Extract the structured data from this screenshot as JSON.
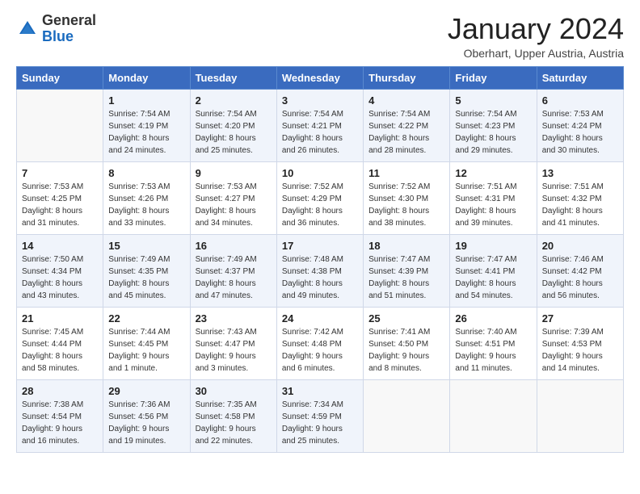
{
  "logo": {
    "general": "General",
    "blue": "Blue"
  },
  "header": {
    "title": "January 2024",
    "location": "Oberhart, Upper Austria, Austria"
  },
  "weekdays": [
    "Sunday",
    "Monday",
    "Tuesday",
    "Wednesday",
    "Thursday",
    "Friday",
    "Saturday"
  ],
  "weeks": [
    [
      {
        "day": "",
        "sunrise": "",
        "sunset": "",
        "daylight": ""
      },
      {
        "day": "1",
        "sunrise": "Sunrise: 7:54 AM",
        "sunset": "Sunset: 4:19 PM",
        "daylight": "Daylight: 8 hours and 24 minutes."
      },
      {
        "day": "2",
        "sunrise": "Sunrise: 7:54 AM",
        "sunset": "Sunset: 4:20 PM",
        "daylight": "Daylight: 8 hours and 25 minutes."
      },
      {
        "day": "3",
        "sunrise": "Sunrise: 7:54 AM",
        "sunset": "Sunset: 4:21 PM",
        "daylight": "Daylight: 8 hours and 26 minutes."
      },
      {
        "day": "4",
        "sunrise": "Sunrise: 7:54 AM",
        "sunset": "Sunset: 4:22 PM",
        "daylight": "Daylight: 8 hours and 28 minutes."
      },
      {
        "day": "5",
        "sunrise": "Sunrise: 7:54 AM",
        "sunset": "Sunset: 4:23 PM",
        "daylight": "Daylight: 8 hours and 29 minutes."
      },
      {
        "day": "6",
        "sunrise": "Sunrise: 7:53 AM",
        "sunset": "Sunset: 4:24 PM",
        "daylight": "Daylight: 8 hours and 30 minutes."
      }
    ],
    [
      {
        "day": "7",
        "sunrise": "Sunrise: 7:53 AM",
        "sunset": "Sunset: 4:25 PM",
        "daylight": "Daylight: 8 hours and 31 minutes."
      },
      {
        "day": "8",
        "sunrise": "Sunrise: 7:53 AM",
        "sunset": "Sunset: 4:26 PM",
        "daylight": "Daylight: 8 hours and 33 minutes."
      },
      {
        "day": "9",
        "sunrise": "Sunrise: 7:53 AM",
        "sunset": "Sunset: 4:27 PM",
        "daylight": "Daylight: 8 hours and 34 minutes."
      },
      {
        "day": "10",
        "sunrise": "Sunrise: 7:52 AM",
        "sunset": "Sunset: 4:29 PM",
        "daylight": "Daylight: 8 hours and 36 minutes."
      },
      {
        "day": "11",
        "sunrise": "Sunrise: 7:52 AM",
        "sunset": "Sunset: 4:30 PM",
        "daylight": "Daylight: 8 hours and 38 minutes."
      },
      {
        "day": "12",
        "sunrise": "Sunrise: 7:51 AM",
        "sunset": "Sunset: 4:31 PM",
        "daylight": "Daylight: 8 hours and 39 minutes."
      },
      {
        "day": "13",
        "sunrise": "Sunrise: 7:51 AM",
        "sunset": "Sunset: 4:32 PM",
        "daylight": "Daylight: 8 hours and 41 minutes."
      }
    ],
    [
      {
        "day": "14",
        "sunrise": "Sunrise: 7:50 AM",
        "sunset": "Sunset: 4:34 PM",
        "daylight": "Daylight: 8 hours and 43 minutes."
      },
      {
        "day": "15",
        "sunrise": "Sunrise: 7:49 AM",
        "sunset": "Sunset: 4:35 PM",
        "daylight": "Daylight: 8 hours and 45 minutes."
      },
      {
        "day": "16",
        "sunrise": "Sunrise: 7:49 AM",
        "sunset": "Sunset: 4:37 PM",
        "daylight": "Daylight: 8 hours and 47 minutes."
      },
      {
        "day": "17",
        "sunrise": "Sunrise: 7:48 AM",
        "sunset": "Sunset: 4:38 PM",
        "daylight": "Daylight: 8 hours and 49 minutes."
      },
      {
        "day": "18",
        "sunrise": "Sunrise: 7:47 AM",
        "sunset": "Sunset: 4:39 PM",
        "daylight": "Daylight: 8 hours and 51 minutes."
      },
      {
        "day": "19",
        "sunrise": "Sunrise: 7:47 AM",
        "sunset": "Sunset: 4:41 PM",
        "daylight": "Daylight: 8 hours and 54 minutes."
      },
      {
        "day": "20",
        "sunrise": "Sunrise: 7:46 AM",
        "sunset": "Sunset: 4:42 PM",
        "daylight": "Daylight: 8 hours and 56 minutes."
      }
    ],
    [
      {
        "day": "21",
        "sunrise": "Sunrise: 7:45 AM",
        "sunset": "Sunset: 4:44 PM",
        "daylight": "Daylight: 8 hours and 58 minutes."
      },
      {
        "day": "22",
        "sunrise": "Sunrise: 7:44 AM",
        "sunset": "Sunset: 4:45 PM",
        "daylight": "Daylight: 9 hours and 1 minute."
      },
      {
        "day": "23",
        "sunrise": "Sunrise: 7:43 AM",
        "sunset": "Sunset: 4:47 PM",
        "daylight": "Daylight: 9 hours and 3 minutes."
      },
      {
        "day": "24",
        "sunrise": "Sunrise: 7:42 AM",
        "sunset": "Sunset: 4:48 PM",
        "daylight": "Daylight: 9 hours and 6 minutes."
      },
      {
        "day": "25",
        "sunrise": "Sunrise: 7:41 AM",
        "sunset": "Sunset: 4:50 PM",
        "daylight": "Daylight: 9 hours and 8 minutes."
      },
      {
        "day": "26",
        "sunrise": "Sunrise: 7:40 AM",
        "sunset": "Sunset: 4:51 PM",
        "daylight": "Daylight: 9 hours and 11 minutes."
      },
      {
        "day": "27",
        "sunrise": "Sunrise: 7:39 AM",
        "sunset": "Sunset: 4:53 PM",
        "daylight": "Daylight: 9 hours and 14 minutes."
      }
    ],
    [
      {
        "day": "28",
        "sunrise": "Sunrise: 7:38 AM",
        "sunset": "Sunset: 4:54 PM",
        "daylight": "Daylight: 9 hours and 16 minutes."
      },
      {
        "day": "29",
        "sunrise": "Sunrise: 7:36 AM",
        "sunset": "Sunset: 4:56 PM",
        "daylight": "Daylight: 9 hours and 19 minutes."
      },
      {
        "day": "30",
        "sunrise": "Sunrise: 7:35 AM",
        "sunset": "Sunset: 4:58 PM",
        "daylight": "Daylight: 9 hours and 22 minutes."
      },
      {
        "day": "31",
        "sunrise": "Sunrise: 7:34 AM",
        "sunset": "Sunset: 4:59 PM",
        "daylight": "Daylight: 9 hours and 25 minutes."
      },
      {
        "day": "",
        "sunrise": "",
        "sunset": "",
        "daylight": ""
      },
      {
        "day": "",
        "sunrise": "",
        "sunset": "",
        "daylight": ""
      },
      {
        "day": "",
        "sunrise": "",
        "sunset": "",
        "daylight": ""
      }
    ]
  ]
}
